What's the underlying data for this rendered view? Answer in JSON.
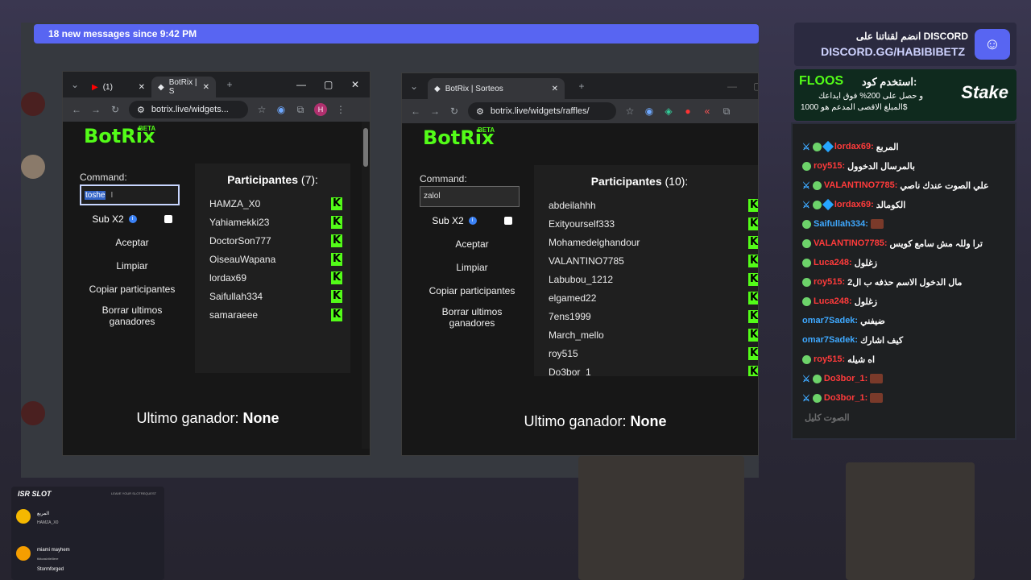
{
  "discord": {
    "banner": "18 new messages since 9:42 PM"
  },
  "left_browser": {
    "tabs": [
      {
        "label": "(1)"
      },
      {
        "label": "BotRix | S"
      }
    ],
    "url": "botrix.live/widgets...",
    "profile_initial": "H",
    "logo": "BotRix",
    "beta": "BETA",
    "command_label": "Command:",
    "command_value": "toshe",
    "sub_label": "Sub X2",
    "buttons": [
      "Aceptar",
      "Limpiar",
      "Copiar participantes",
      "Borrar ultimos ganadores"
    ],
    "participants_title": "Participantes",
    "participants_count": "(7):",
    "participants": [
      "HAMZA_X0",
      "Yahiamekki23",
      "DoctorSon777",
      "OiseauWapana",
      "lordax69",
      "Saifullah334",
      "samaraeee"
    ],
    "winner_label": "Ultimo ganador:",
    "winner_value": "None"
  },
  "right_browser": {
    "tab": "BotRix | Sorteos",
    "url": "botrix.live/widgets/raffles/",
    "logo": "BotRix",
    "beta": "BETA",
    "command_label": "Command:",
    "command_value": "zalol",
    "sub_label": "Sub X2",
    "buttons": [
      "Aceptar",
      "Limpiar",
      "Copiar participantes",
      "Borrar ultimos ganadores"
    ],
    "participants_title": "Participantes",
    "participants_count": "(10):",
    "participants": [
      "abdeilahhh",
      "Exityourself333",
      "Mohamedelghandour",
      "VALANTINO7785",
      "Labubou_1212",
      "elgamed22",
      "7ens1999",
      "March_mello",
      "roy515",
      "Do3bor_1"
    ],
    "winner_label": "Ultimo ganador:",
    "winner_value": "None"
  },
  "promo": {
    "discord_line1": "انضم لقناتنا على DISCORD",
    "discord_line2": "DISCORD.GG/HABIBIBETZ",
    "stake_code_label": "استخدم كود:",
    "stake_code": "FLOOS",
    "stake_line2": "و حصل على 200% فوق ايداعك",
    "stake_line3": "المبلغ الاقصى المدعم هو 1000$",
    "stake_brand": "Stake"
  },
  "chat": [
    {
      "user": "lordax69:",
      "msg": "المربع",
      "color": "#ff3b3b",
      "badges": [
        "sword",
        "badge",
        "gem"
      ]
    },
    {
      "user": "roy515:",
      "msg": "بالمرسال الدخوول",
      "color": "#ff3b3b",
      "badges": [
        "badge"
      ]
    },
    {
      "user": "VALANTINO7785:",
      "msg": "علي الصوت عندك ناصي",
      "color": "#ff3b3b",
      "badges": [
        "sword",
        "badge"
      ]
    },
    {
      "user": "lordax69:",
      "msg": "الكومالد",
      "color": "#ff3b3b",
      "badges": [
        "sword",
        "badge",
        "gem"
      ]
    },
    {
      "user": "Saifullah334:",
      "msg": "",
      "color": "#3fa9ff",
      "badges": [
        "badge"
      ],
      "emote": true
    },
    {
      "user": "VALANTINO7785:",
      "msg": "ترا وللہ مش سامع كويس",
      "color": "#ff3b3b",
      "badges": [
        "badge"
      ]
    },
    {
      "user": "Luca248:",
      "msg": "زغلول",
      "color": "#ff3b3b",
      "badges": [
        "badge"
      ]
    },
    {
      "user": "roy515:",
      "msg": "مال الدخول الاسم حذفه ب ال2",
      "color": "#ff3b3b",
      "badges": [
        "badge"
      ]
    },
    {
      "user": "Luca248:",
      "msg": "زغلول",
      "color": "#ff3b3b",
      "badges": [
        "badge"
      ]
    },
    {
      "user": "omar7Sadek:",
      "msg": "ضيفني",
      "color": "#3fa9ff",
      "badges": []
    },
    {
      "user": "omar7Sadek:",
      "msg": "كيف اشارك",
      "color": "#3fa9ff",
      "badges": []
    },
    {
      "user": "roy515:",
      "msg": "اه شيله",
      "color": "#ff3b3b",
      "badges": [
        "badge"
      ]
    },
    {
      "user": "Do3bor_1:",
      "msg": "",
      "color": "#ff3b3b",
      "badges": [
        "sword",
        "badge"
      ],
      "emote": true
    },
    {
      "user": "Do3bor_1:",
      "msg": "",
      "color": "#ff3b3b",
      "badges": [
        "sword",
        "badge"
      ],
      "emote": true
    },
    {
      "user": "",
      "msg": "الصوت كليل",
      "color": "#ff3b3b",
      "badges": [],
      "faded": true
    }
  ],
  "slot_widget": {
    "title": "ISR SLOT",
    "subtitle": "LEAVE YOUR SLOTREQUEST",
    "entries": [
      {
        "line1": "المربع",
        "line2": "HAMZA_X0"
      },
      {
        "line1": "miami mayhem",
        "line2": "tiktoasbitelliere"
      },
      {
        "line1": "Stormforged",
        "line2": ""
      }
    ]
  },
  "colors": {
    "kick_green": "#53fc18",
    "discord_blurple": "#5865f2"
  }
}
